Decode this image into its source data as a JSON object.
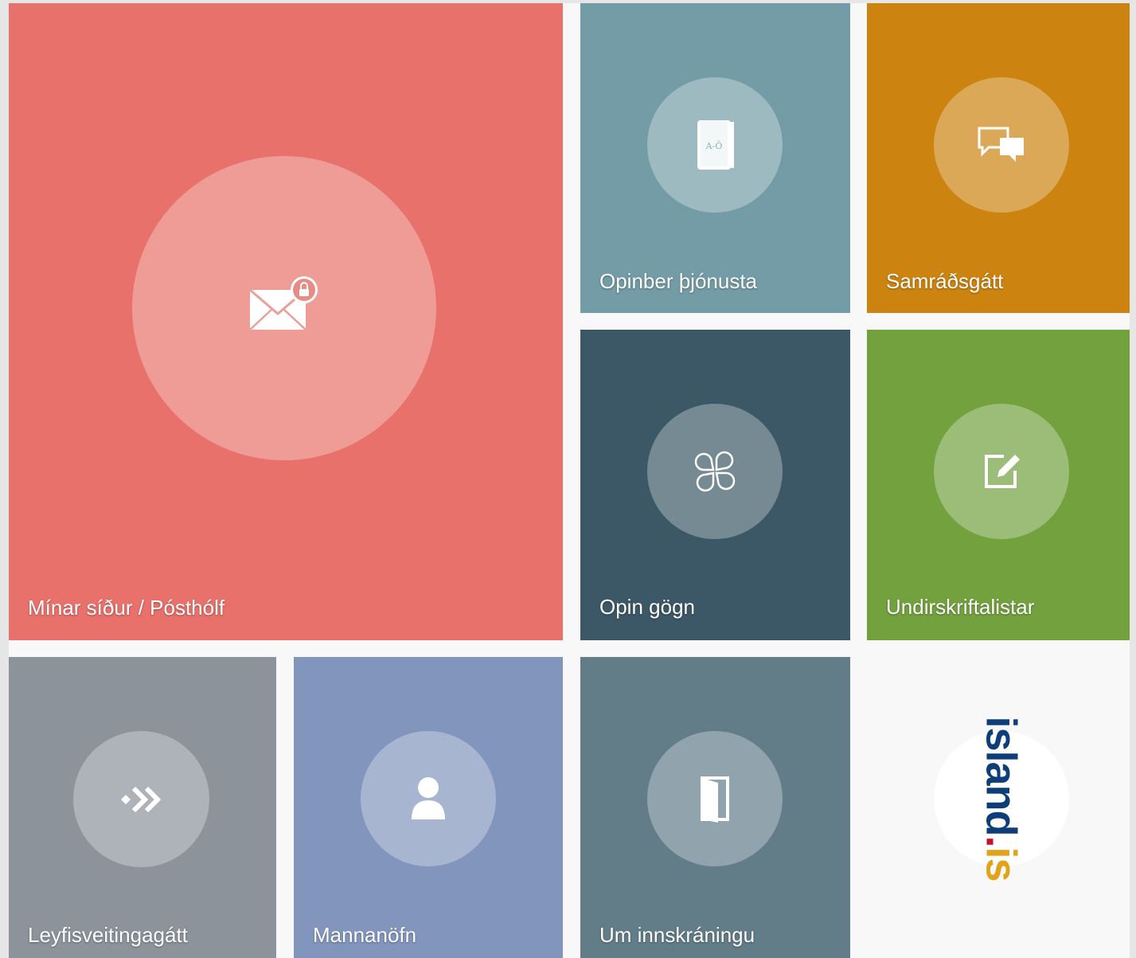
{
  "tiles": [
    {
      "id": "minar-sidur",
      "label": "Mínar síður / Pósthólf",
      "color": "#e8716b",
      "icon": "mail-lock-icon"
    },
    {
      "id": "opinber-thjonusta",
      "label": "Opinber þjónusta",
      "color": "#739ca6",
      "icon": "book-icon",
      "icon_text": "A-Ö"
    },
    {
      "id": "samradsgatt",
      "label": "Samráðsgátt",
      "color": "#cc8310",
      "icon": "chat-bubbles-icon"
    },
    {
      "id": "opin-gogn",
      "label": "Opin gögn",
      "color": "#3c5866",
      "icon": "open-data-icon"
    },
    {
      "id": "undirskriftalistar",
      "label": "Undirskriftalistar",
      "color": "#72a13e",
      "icon": "edit-icon"
    },
    {
      "id": "leyfisveitingagatt",
      "label": "Leyfisveitingagátt",
      "color": "#8c939b",
      "icon": "arrows-right-icon"
    },
    {
      "id": "mannanofn",
      "label": "Mannanöfn",
      "color": "#8295bd",
      "icon": "person-icon"
    },
    {
      "id": "um-innskraningu",
      "label": "Um innskráningu",
      "color": "#627c88",
      "icon": "door-icon"
    }
  ],
  "logo": {
    "main": "island",
    "dot": ".",
    "suffix": "is",
    "main_color": "#0d3e7a",
    "accent_color": "#e2a31b",
    "dot_color": "#c8102e"
  }
}
